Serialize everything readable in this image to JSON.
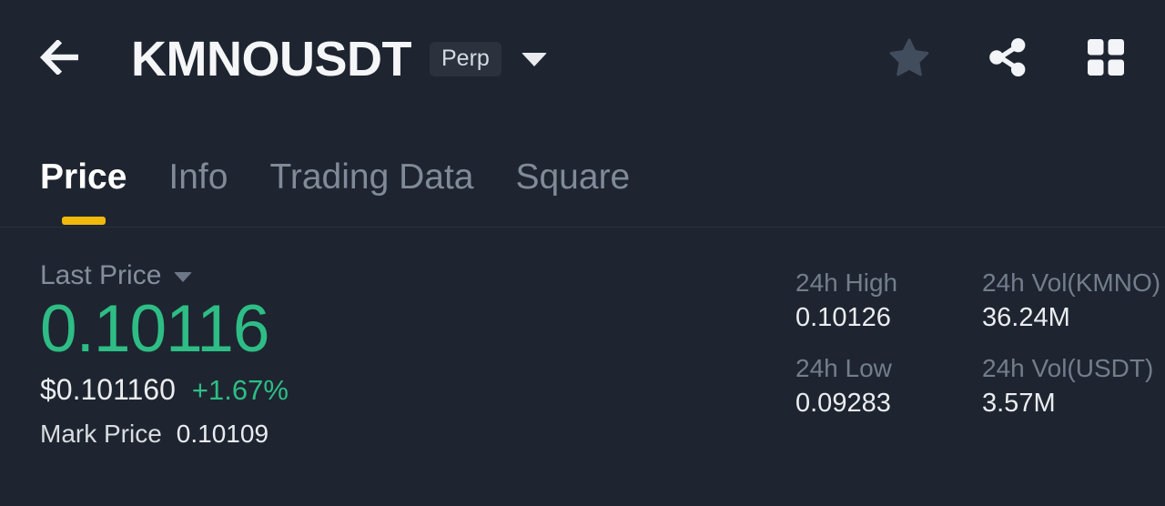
{
  "theme": {
    "background": "#1e2530",
    "accent_yellow": "#f0b90b",
    "positive_green": "#2ebd85",
    "text_primary": "#eaecef",
    "text_muted": "#848e9c",
    "badge_bg": "#2b323e"
  },
  "header": {
    "back_icon": "arrow-left-icon",
    "symbol": "KMNOUSDT",
    "contract_badge": "Perp",
    "dropdown_icon": "chevron-down-icon",
    "actions": [
      {
        "name": "favorite",
        "icon": "star-icon"
      },
      {
        "name": "share",
        "icon": "share-icon"
      },
      {
        "name": "grid-view",
        "icon": "grid-icon"
      }
    ]
  },
  "tabs": [
    {
      "label": "Price",
      "active": true
    },
    {
      "label": "Info",
      "active": false
    },
    {
      "label": "Trading Data",
      "active": false
    },
    {
      "label": "Square",
      "active": false
    }
  ],
  "price": {
    "label": "Last Price",
    "label_dropdown_icon": "caret-down-icon",
    "value": "0.10116",
    "fiat_value": "$0.101160",
    "change_percent": "+1.67%",
    "mark_price_label": "Mark Price",
    "mark_price_value": "0.10109"
  },
  "stats": [
    {
      "label": "24h High",
      "value": "0.10126"
    },
    {
      "label": "24h Vol(KMNO)",
      "value": "36.24M"
    },
    {
      "label": "24h Low",
      "value": "0.09283"
    },
    {
      "label": "24h Vol(USDT)",
      "value": "3.57M"
    }
  ]
}
